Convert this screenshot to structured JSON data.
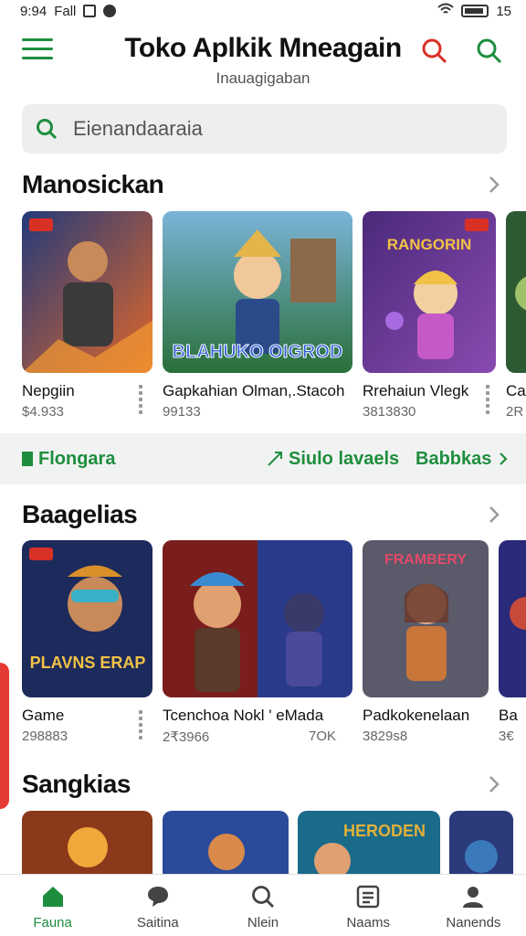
{
  "status_bar": {
    "time": "9:94",
    "indicators": "Fall",
    "battery_text": "15"
  },
  "header": {
    "title": "Toko Aplkik Mneagain",
    "subtitle": "Inauagigaban"
  },
  "search": {
    "placeholder": "Eienandaaraia"
  },
  "sections": [
    {
      "title": "Manosickan",
      "cards": [
        {
          "title": "Nepgiin",
          "sub": "$4.933",
          "palette": [
            "#233a7a",
            "#e0672a"
          ]
        },
        {
          "title": "Gapkahian Olman,.Stacoh",
          "sub": "99133",
          "palette": [
            "#2a6f3a",
            "#e3b54a"
          ]
        },
        {
          "title": "Rrehaiun Vlegk",
          "sub": "3813830",
          "palette": [
            "#4a2a7a",
            "#e2a84c"
          ]
        },
        {
          "title": "Ca",
          "sub": "2R",
          "palette": [
            "#2e5a33",
            "#9ec16a"
          ]
        }
      ]
    },
    {
      "title": "Baagelias",
      "cards": [
        {
          "title": "Game",
          "sub": "298883",
          "art_text": "PLAVNS ERAP",
          "palette": [
            "#1c2a5c",
            "#d9902a"
          ]
        },
        {
          "title": "Tcenchoa Nokl ' eMada",
          "sub": "2₹3966",
          "sub2": "7OK",
          "palette": [
            "#7a1d1d",
            "#2a3a8a"
          ]
        },
        {
          "title": "Padkokenelaan",
          "sub": "3829s8",
          "art_text": "FRAMBERY",
          "palette": [
            "#5a5a6a",
            "#c8763a"
          ]
        },
        {
          "title": "Ba",
          "sub": "3€",
          "palette": [
            "#2a2a7a",
            "#c84a3a"
          ]
        }
      ]
    },
    {
      "title": "Sangkias",
      "cards": [
        {
          "palette": [
            "#8a3a1a",
            "#f0a83a"
          ]
        },
        {
          "palette": [
            "#2a4a9a",
            "#d98a4a"
          ]
        },
        {
          "art_text": "HERODEN",
          "palette": [
            "#1a6a8a",
            "#e0b03a"
          ]
        },
        {
          "palette": [
            "#2a3a7a",
            "#3a7aba"
          ]
        }
      ]
    }
  ],
  "filters": {
    "primary": "Flongara",
    "trending": "Siulo lavaels",
    "more": "Babbkas"
  },
  "art_badge_1": "BLAHUKO OIGROD",
  "art_badge_3": "RANGORIN",
  "bottom_nav": [
    {
      "label": "Fauna",
      "icon": "home-icon",
      "active": true
    },
    {
      "label": "Saitina",
      "icon": "chat-icon",
      "active": false
    },
    {
      "label": "Nlein",
      "icon": "search-icon",
      "active": false
    },
    {
      "label": "Naams",
      "icon": "list-icon",
      "active": false
    },
    {
      "label": "Nanends",
      "icon": "profile-icon",
      "active": false
    }
  ],
  "colors": {
    "accent_green": "#1e8e3e",
    "accent_red": "#d93025"
  }
}
